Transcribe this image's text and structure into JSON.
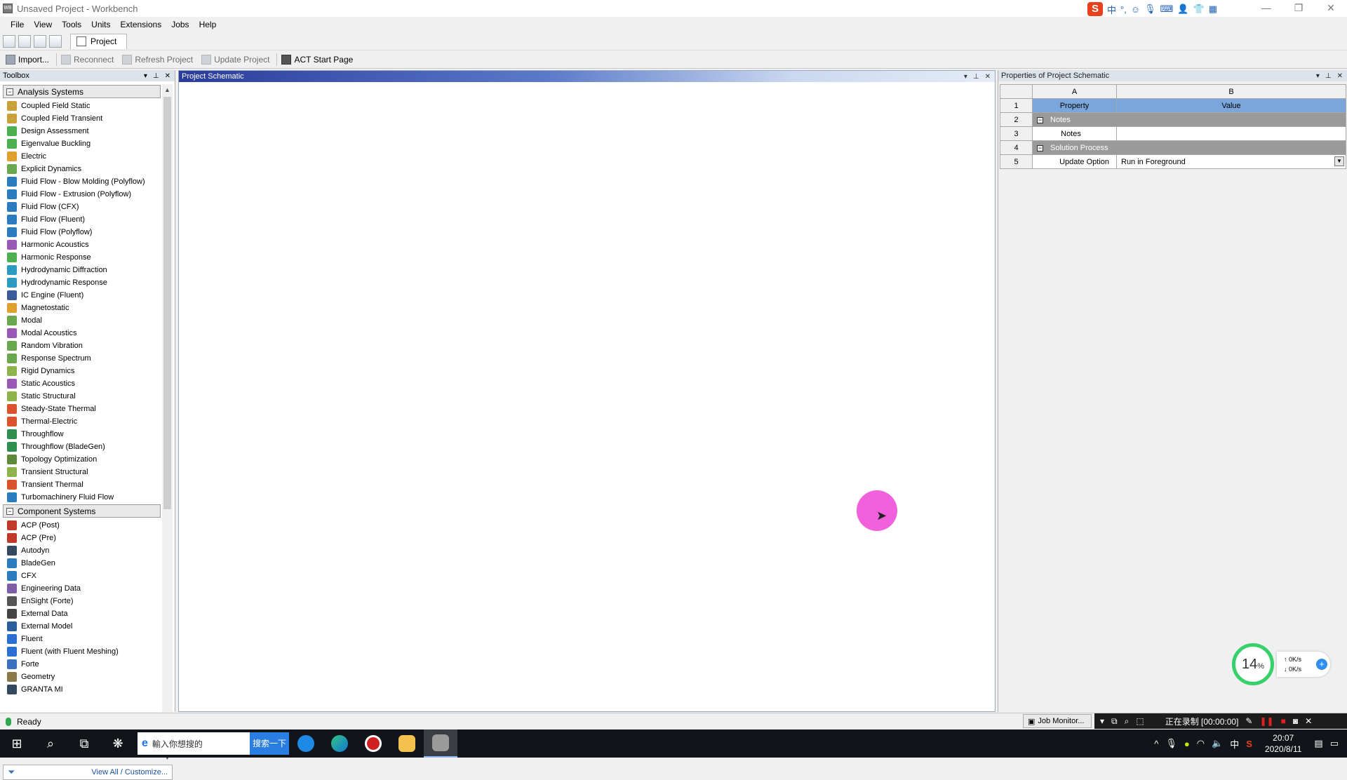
{
  "window": {
    "title": "Unsaved Project - Workbench",
    "icon": "WB",
    "controls": [
      "—",
      "❐",
      "✕"
    ]
  },
  "ime": {
    "logo": "S",
    "items": [
      "中",
      "°,",
      "☺",
      "🎙",
      "⌨",
      "👤",
      "👕",
      "▦"
    ]
  },
  "menu": [
    "File",
    "View",
    "Tools",
    "Units",
    "Extensions",
    "Jobs",
    "Help"
  ],
  "toolbar1": {
    "tab_label": "Project"
  },
  "toolbar2": {
    "import": "Import...",
    "reconnect": "Reconnect",
    "refresh": "Refresh Project",
    "update": "Update Project",
    "act": "ACT Start Page"
  },
  "toolbox": {
    "title": "Toolbox",
    "groups": [
      {
        "label": "Analysis Systems",
        "items": [
          {
            "label": "Coupled Field Static",
            "color": "#c9a13b"
          },
          {
            "label": "Coupled Field Transient",
            "color": "#c9a13b"
          },
          {
            "label": "Design Assessment",
            "color": "#4caf50"
          },
          {
            "label": "Eigenvalue Buckling",
            "color": "#4caf50"
          },
          {
            "label": "Electric",
            "color": "#e0a030"
          },
          {
            "label": "Explicit Dynamics",
            "color": "#6aa84f"
          },
          {
            "label": "Fluid Flow - Blow Molding (Polyflow)",
            "color": "#2b7bbf"
          },
          {
            "label": "Fluid Flow - Extrusion (Polyflow)",
            "color": "#2b7bbf"
          },
          {
            "label": "Fluid Flow (CFX)",
            "color": "#2b7bbf"
          },
          {
            "label": "Fluid Flow (Fluent)",
            "color": "#2b7bbf"
          },
          {
            "label": "Fluid Flow (Polyflow)",
            "color": "#2b7bbf"
          },
          {
            "label": "Harmonic Acoustics",
            "color": "#9b59b6"
          },
          {
            "label": "Harmonic Response",
            "color": "#4caf50"
          },
          {
            "label": "Hydrodynamic Diffraction",
            "color": "#2b9bbf"
          },
          {
            "label": "Hydrodynamic Response",
            "color": "#2b9bbf"
          },
          {
            "label": "IC Engine (Fluent)",
            "color": "#3d5a99"
          },
          {
            "label": "Magnetostatic",
            "color": "#e0a030"
          },
          {
            "label": "Modal",
            "color": "#6aa84f"
          },
          {
            "label": "Modal Acoustics",
            "color": "#9b59b6"
          },
          {
            "label": "Random Vibration",
            "color": "#6aa84f"
          },
          {
            "label": "Response Spectrum",
            "color": "#6aa84f"
          },
          {
            "label": "Rigid Dynamics",
            "color": "#8db34a"
          },
          {
            "label": "Static Acoustics",
            "color": "#9b59b6"
          },
          {
            "label": "Static Structural",
            "color": "#8db34a"
          },
          {
            "label": "Steady-State Thermal",
            "color": "#d9532c"
          },
          {
            "label": "Thermal-Electric",
            "color": "#d9532c"
          },
          {
            "label": "Throughflow",
            "color": "#2f8f4f"
          },
          {
            "label": "Throughflow (BladeGen)",
            "color": "#2f8f4f"
          },
          {
            "label": "Topology Optimization",
            "color": "#5c8a3a"
          },
          {
            "label": "Transient Structural",
            "color": "#8db34a"
          },
          {
            "label": "Transient Thermal",
            "color": "#d9532c"
          },
          {
            "label": "Turbomachinery Fluid Flow",
            "color": "#2b7bbf"
          }
        ]
      },
      {
        "label": "Component Systems",
        "items": [
          {
            "label": "ACP (Post)",
            "color": "#c0392b"
          },
          {
            "label": "ACP (Pre)",
            "color": "#c0392b"
          },
          {
            "label": "Autodyn",
            "color": "#34495e"
          },
          {
            "label": "BladeGen",
            "color": "#2b7bbf"
          },
          {
            "label": "CFX",
            "color": "#2b7bbf"
          },
          {
            "label": "Engineering Data",
            "color": "#7d5fa8"
          },
          {
            "label": "EnSight (Forte)",
            "color": "#555555"
          },
          {
            "label": "External Data",
            "color": "#444444"
          },
          {
            "label": "External Model",
            "color": "#2b5f9b"
          },
          {
            "label": "Fluent",
            "color": "#2b6fd1"
          },
          {
            "label": "Fluent (with Fluent Meshing)",
            "color": "#2b6fd1"
          },
          {
            "label": "Forte",
            "color": "#3b6fbf"
          },
          {
            "label": "Geometry",
            "color": "#8a7a4a"
          },
          {
            "label": "GRANTA MI",
            "color": "#34495e"
          }
        ]
      }
    ],
    "footer_link": "View All / Customize..."
  },
  "schematic": {
    "title": "Project Schematic"
  },
  "properties": {
    "title": "Properties of Project Schematic",
    "col_a": "A",
    "col_b": "B",
    "rows": [
      {
        "num": "1",
        "property": "Property",
        "value": "Value"
      },
      {
        "num": "2",
        "section": "Notes"
      },
      {
        "num": "3",
        "property": "Notes",
        "value": ""
      },
      {
        "num": "4",
        "section": "Solution Process"
      },
      {
        "num": "5",
        "property": "Update Option",
        "value": "Run in Foreground"
      }
    ]
  },
  "status": {
    "text": "Ready",
    "job_monitor": "Job Monitor...",
    "recording": "正在录制 [00:00:00]"
  },
  "netwidget": {
    "percent": "14",
    "unit": "%",
    "up": "0K/s",
    "down": "0K/s"
  },
  "taskbar": {
    "search_placeholder": "輸入你想搜的",
    "search_button": "搜索一下",
    "clock_time": "20:07",
    "clock_date": "2020/8/11",
    "ime_lang": "中"
  }
}
